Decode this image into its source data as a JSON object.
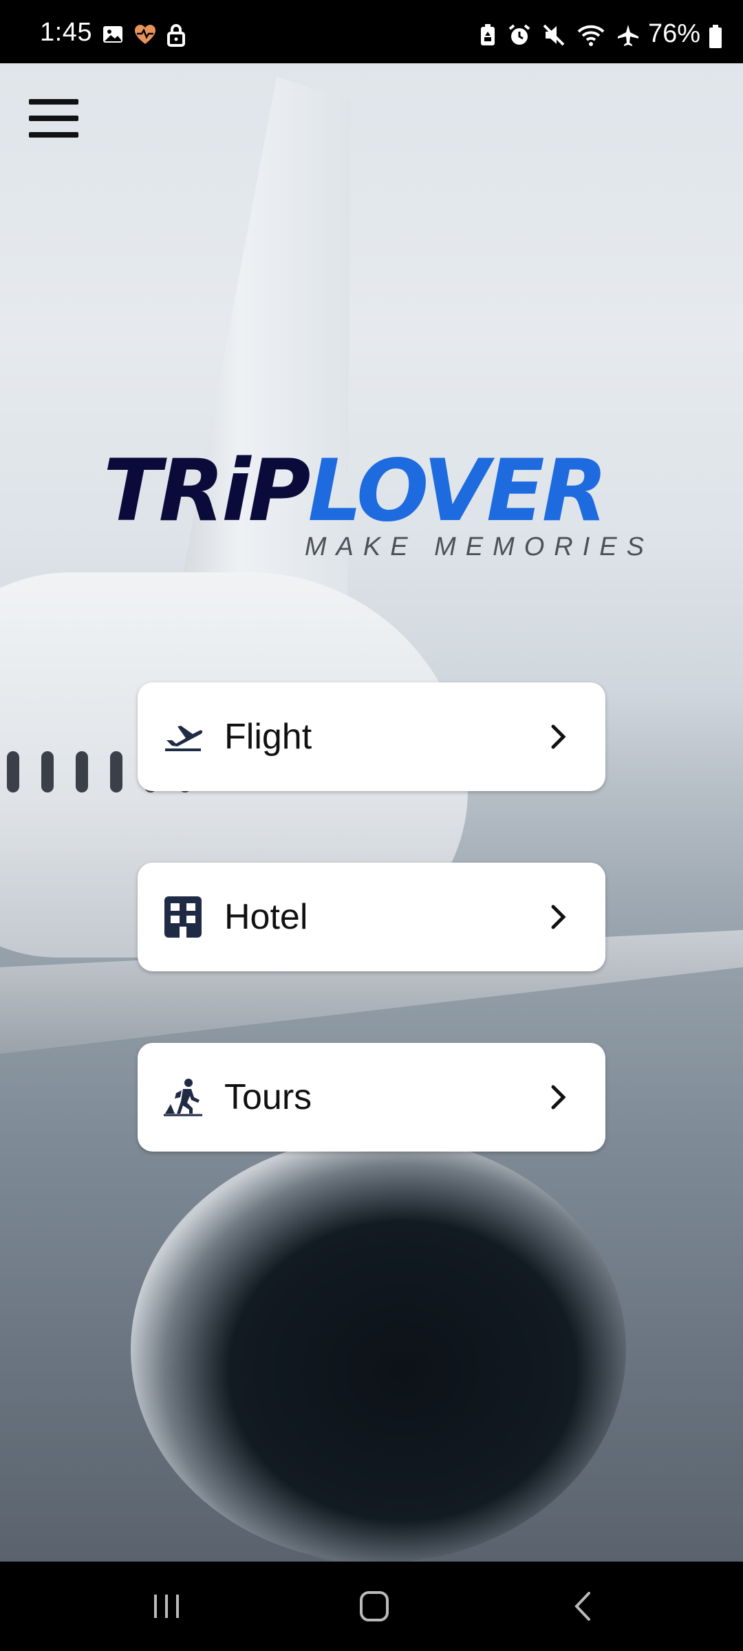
{
  "status_bar": {
    "time": "1:45",
    "battery": "76%"
  },
  "header": {
    "menu_icon": "hamburger-menu-icon"
  },
  "logo": {
    "word_part1": "TRiP",
    "word_part2": "LOVER",
    "tagline": "MAKE MEMORIES"
  },
  "menu": {
    "items": [
      {
        "label": "Flight",
        "icon": "airplane-icon"
      },
      {
        "label": "Hotel",
        "icon": "hotel-building-icon"
      },
      {
        "label": "Tours",
        "icon": "hiker-icon"
      }
    ]
  },
  "colors": {
    "logo_dark": "#0b0b3b",
    "logo_blue": "#1e6be0",
    "icon_navy": "#1f2a44"
  }
}
